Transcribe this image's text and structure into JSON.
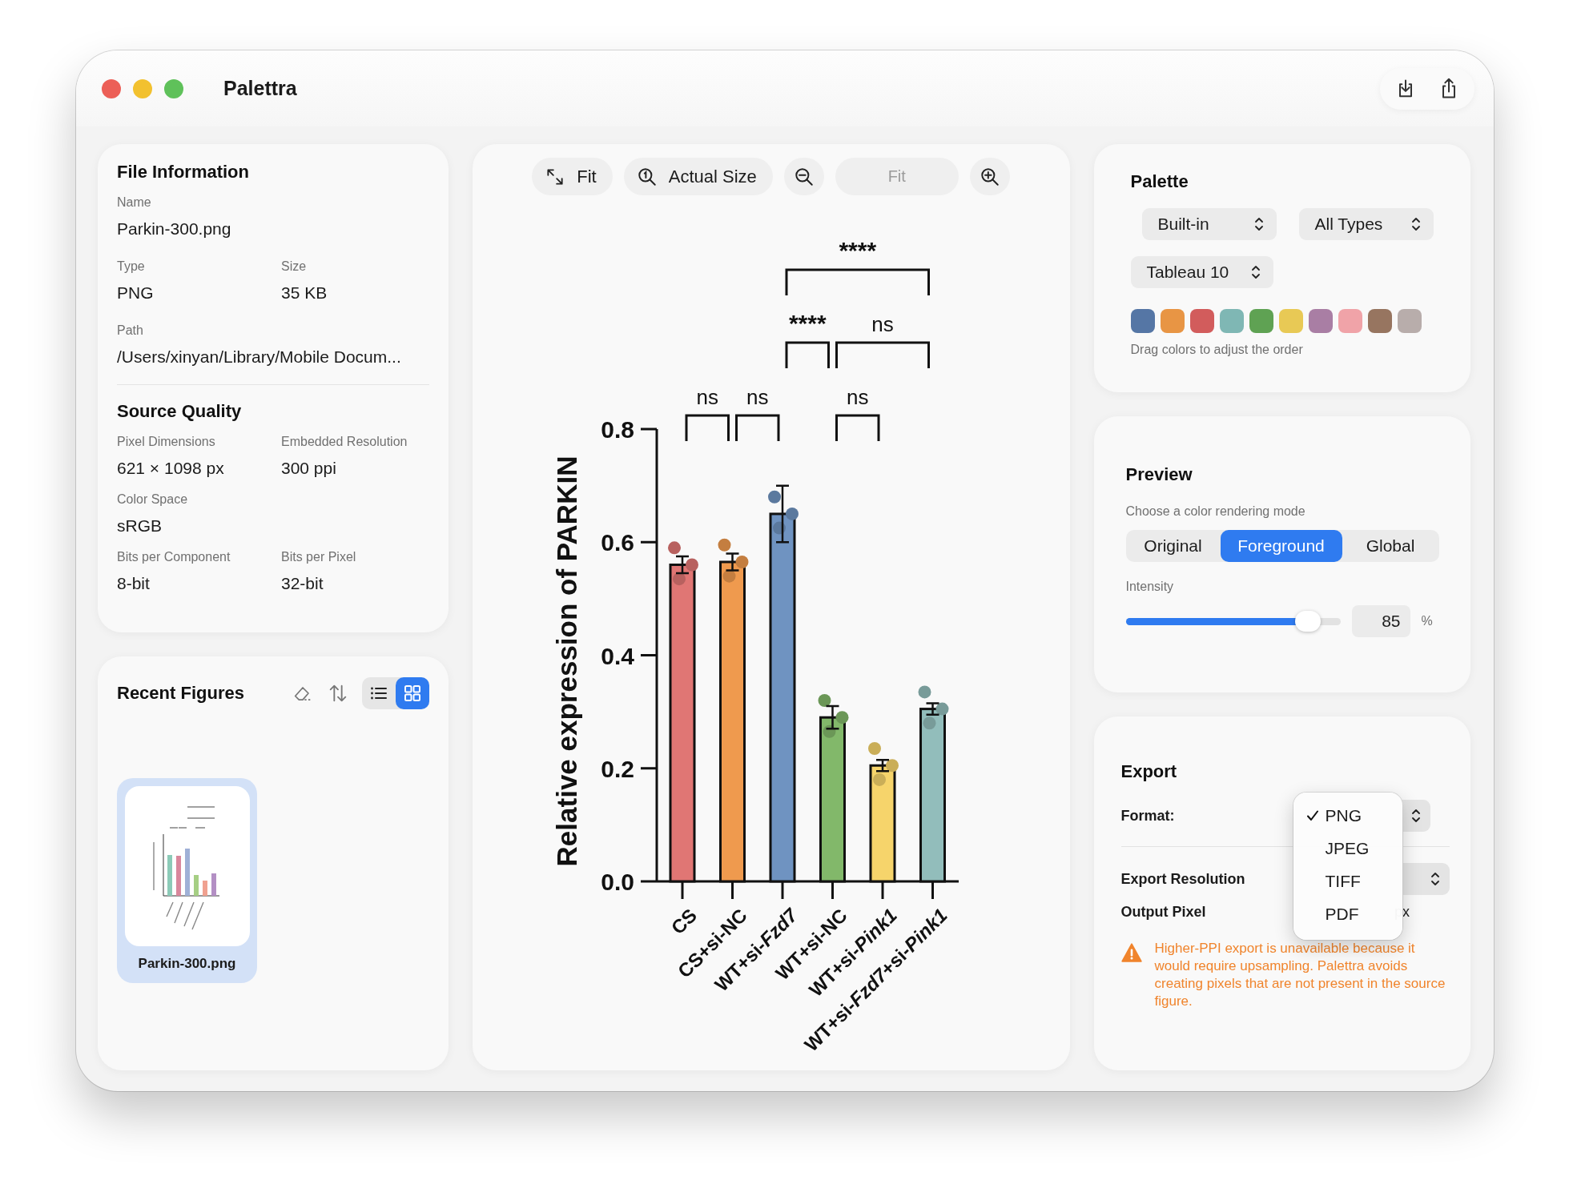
{
  "window": {
    "title": "Palettra"
  },
  "file_information": {
    "title": "File Information",
    "fields": [
      {
        "label": "Name",
        "value": "Parkin-300.png",
        "kind": "wide"
      },
      {
        "label": "Type",
        "value": "PNG",
        "kind": "half"
      },
      {
        "label": "Size",
        "value": "35 KB",
        "kind": "half"
      },
      {
        "label": "Path",
        "value": "/Users/xinyan/Library/Mobile Docum...",
        "kind": "wide"
      }
    ]
  },
  "source_quality": {
    "title": "Source Quality",
    "fields": [
      {
        "label": "Pixel Dimensions",
        "value": "621 × 1098 px",
        "kind": "half"
      },
      {
        "label": "Embedded Resolution",
        "value": "300 ppi",
        "kind": "half"
      },
      {
        "label": "Color Space",
        "value": "sRGB",
        "kind": "wide"
      },
      {
        "label": "Bits per Component",
        "value": "8-bit",
        "kind": "half"
      },
      {
        "label": "Bits per Pixel",
        "value": "32-bit",
        "kind": "half"
      }
    ]
  },
  "recent_figures": {
    "title": "Recent Figures",
    "view_modes": [
      {
        "kind": "list",
        "selected": false
      },
      {
        "kind": "grid",
        "selected": true
      }
    ],
    "items": [
      {
        "name": "Parkin-300.png",
        "selected": true,
        "kind": "picture"
      }
    ]
  },
  "viewer": {
    "toolbar": [
      {
        "kind": "fit",
        "label": "Fit"
      },
      {
        "kind": "actual_size",
        "label": "Actual Size"
      },
      {
        "kind": "zoom_out"
      },
      {
        "kind": "zoom_level",
        "label": "Fit",
        "disabled": true
      },
      {
        "kind": "zoom_in"
      }
    ],
    "chart_data": {
      "type": "bar",
      "ylabel": "Relative expression of PARKIN",
      "categories": [
        "CS",
        "CS+si-NC",
        "WT+si-*Fzd7*",
        "WT+si-NC",
        "WT+si-*Pink1*",
        "WT+si-*Fzd7*+si-*Pink1*"
      ],
      "series": [
        {
          "colors": [
            "#e07674",
            "#ef9a4e",
            "#6f93c1",
            "#82b86a",
            "#f6d46b",
            "#92bdbb"
          ],
          "values": [
            0.56,
            0.565,
            0.65,
            0.29,
            0.205,
            0.305
          ],
          "errors": [
            0.015,
            0.015,
            0.05,
            0.02,
            0.01,
            0.01
          ]
        }
      ],
      "ylim": [
        0,
        0.8
      ],
      "yticks": [
        {
          "value": 0,
          "label": "0.0"
        },
        {
          "value": 0.2,
          "label": "0.2"
        },
        {
          "value": 0.4,
          "label": "0.4"
        },
        {
          "value": 0.6,
          "label": "0.6"
        },
        {
          "value": 0.8,
          "label": "0.8"
        }
      ]
    },
    "significance": [
      {
        "text": "ns"
      },
      {
        "text": "ns"
      },
      {
        "text": "ns"
      },
      {
        "text": "****"
      },
      {
        "text": "ns"
      },
      {
        "text": "****"
      }
    ]
  },
  "palette": {
    "title": "Palette",
    "selects": [
      "Built-in",
      "All Types",
      "Tableau 10"
    ],
    "swatches": [
      {
        "color": "#5576a5"
      },
      {
        "color": "#e89544"
      },
      {
        "color": "#d25c5c"
      },
      {
        "color": "#7fb7b4"
      },
      {
        "color": "#5fa253"
      },
      {
        "color": "#e8c955"
      },
      {
        "color": "#a97ea4"
      },
      {
        "color": "#f0a3a8"
      },
      {
        "color": "#977560"
      },
      {
        "color": "#b8adab"
      }
    ],
    "hint": "Drag colors to adjust the order"
  },
  "preview": {
    "title": "Preview",
    "subtitle": "Choose a color rendering mode",
    "modes": [
      {
        "label": "Original",
        "selected": false
      },
      {
        "label": "Foreground",
        "selected": true
      },
      {
        "label": "Global",
        "selected": false
      }
    ],
    "intensity": {
      "label": "Intensity",
      "level": 0.85,
      "value": "85",
      "unit": "%"
    }
  },
  "export": {
    "title": "Export",
    "rows": [
      {
        "label": "Format:",
        "kind": "select"
      },
      {
        "label": "Export Resolution",
        "kind": "select"
      },
      {
        "label": "Output Pixel",
        "kind": "unit",
        "unit": "px"
      }
    ],
    "format_menu": {
      "open": true,
      "items": [
        {
          "label": "PNG",
          "selected": true
        },
        {
          "label": "JPEG",
          "selected": false
        },
        {
          "label": "TIFF",
          "selected": false
        },
        {
          "label": "PDF",
          "selected": false
        }
      ]
    },
    "warning": "Higher-PPI export is unavailable because it would require upsampling. Palettra avoids creating pixels that are not present in the source figure."
  }
}
